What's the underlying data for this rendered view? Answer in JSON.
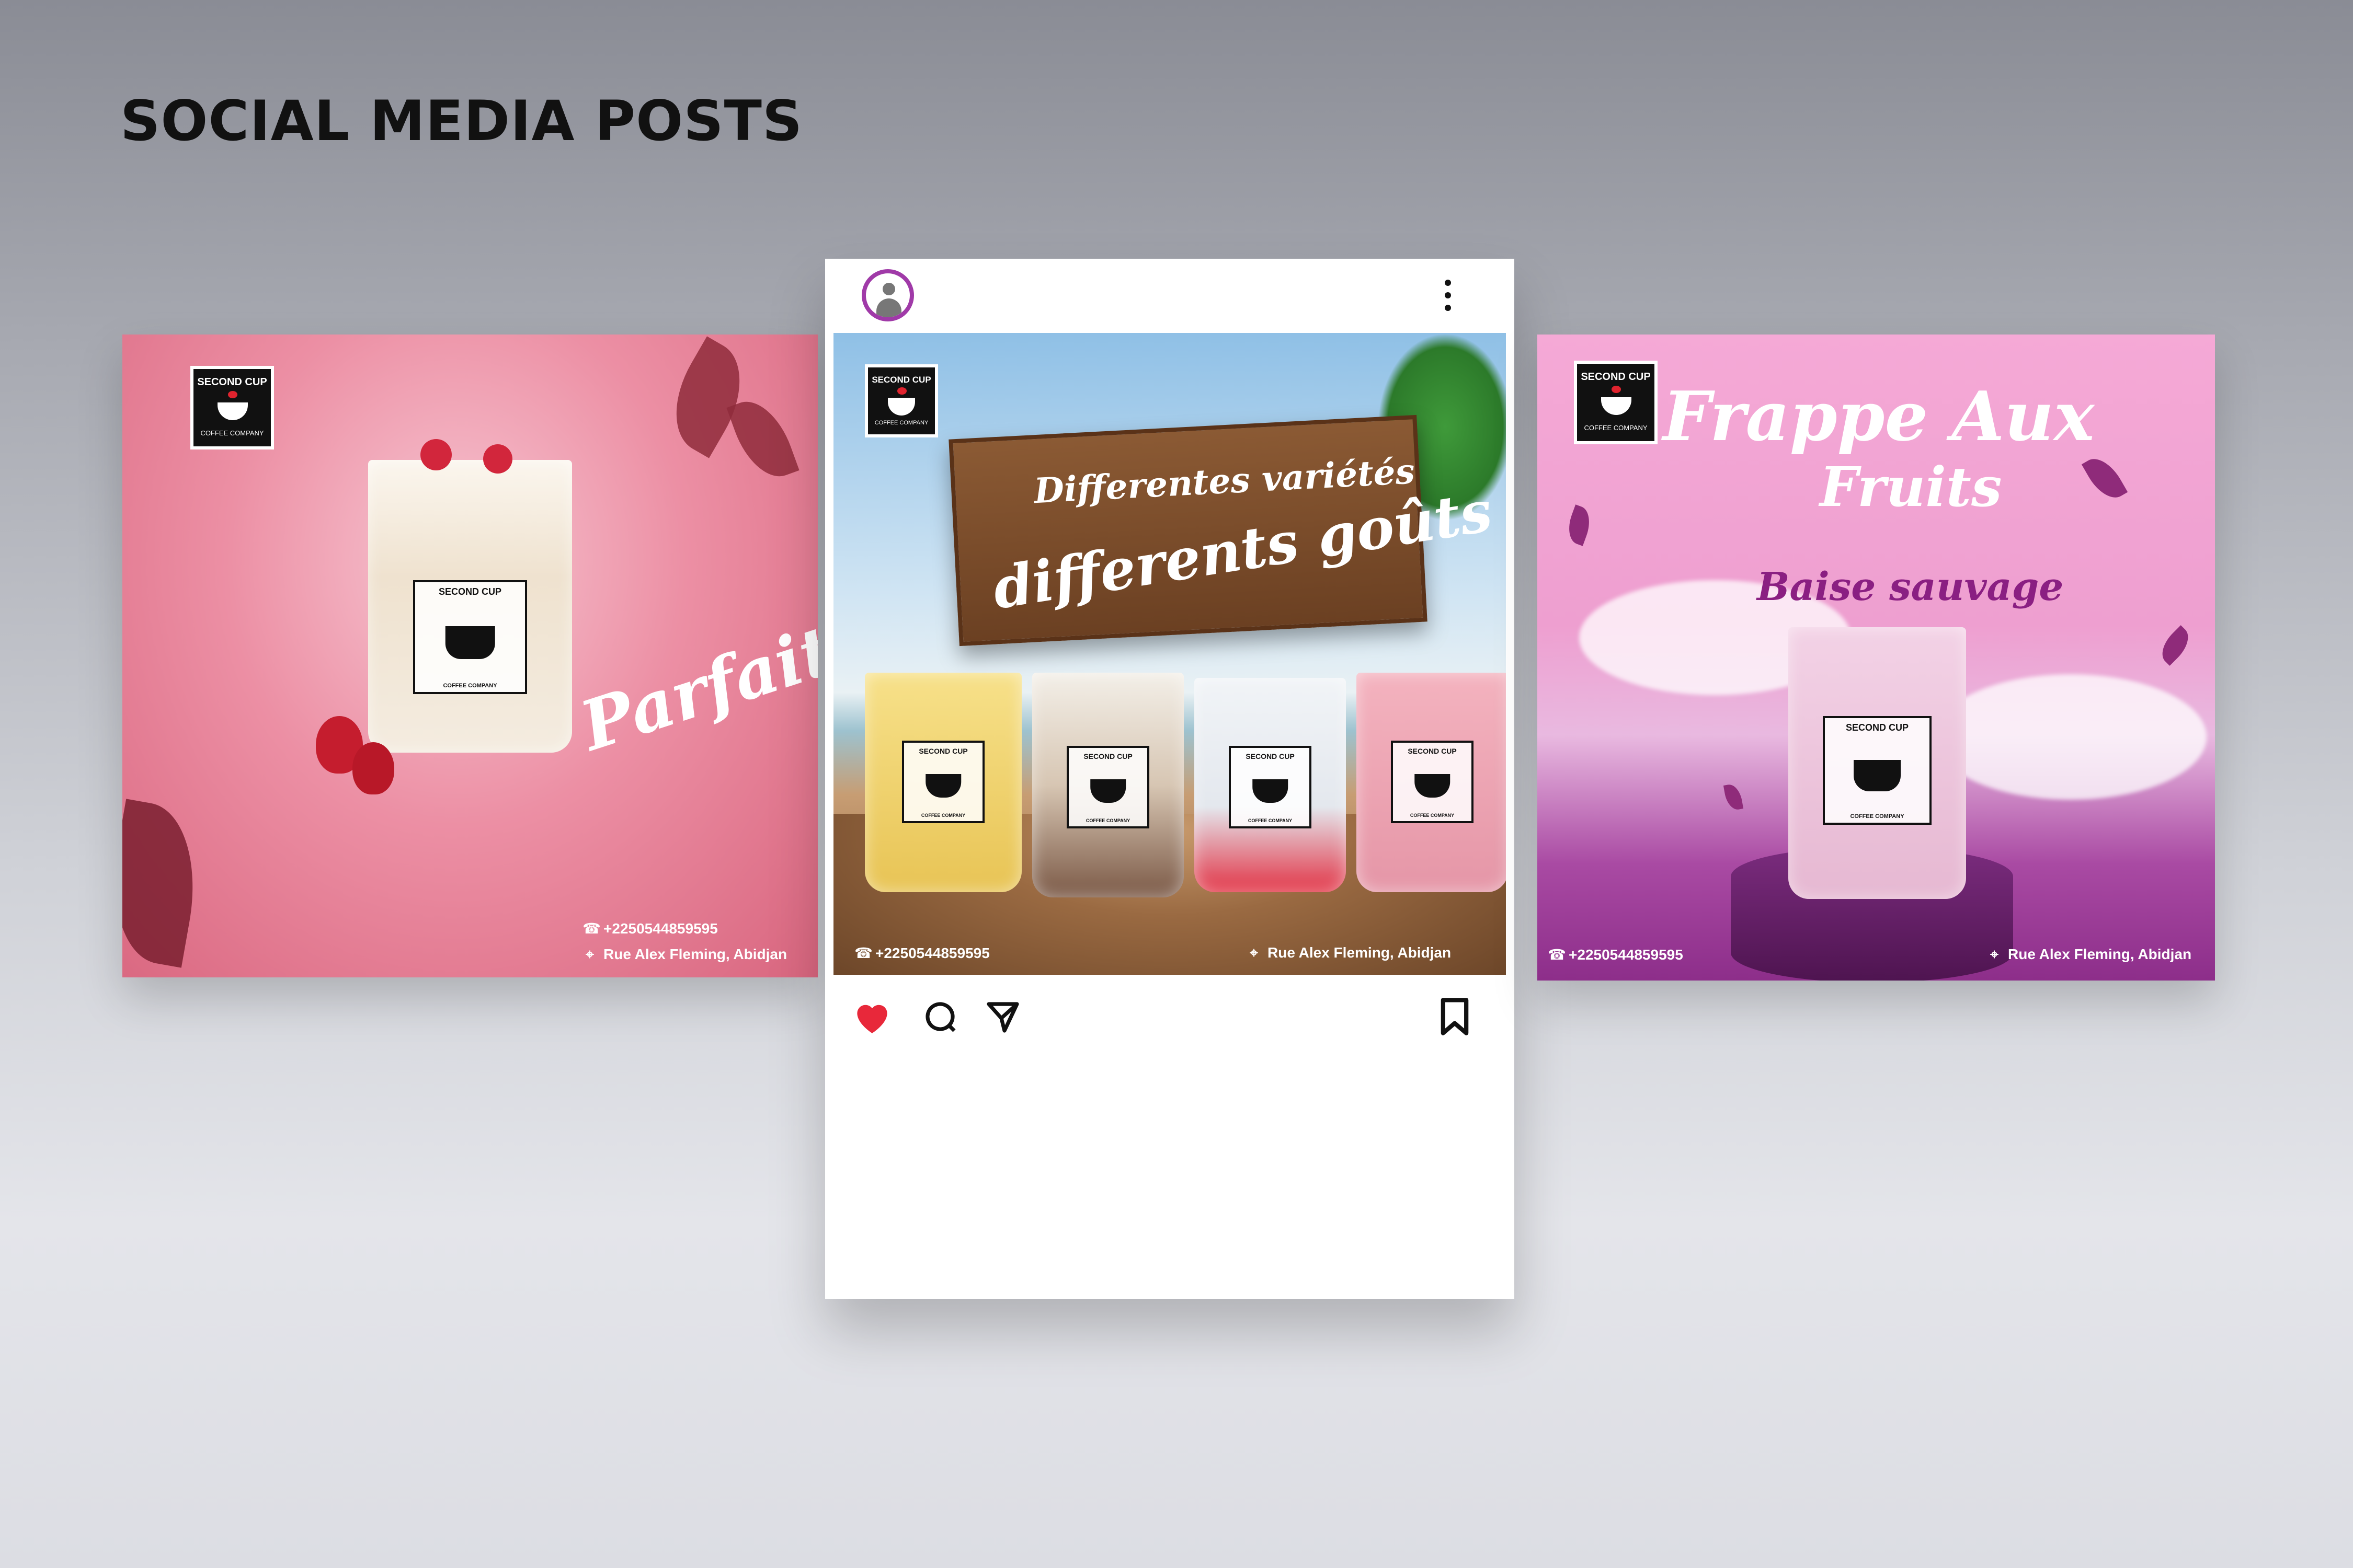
{
  "heading": "SOCIAL MEDIA POSTS",
  "brand": {
    "name_top": "SECOND CUP",
    "name_bottom": "COFFEE COMPANY"
  },
  "contact": {
    "phone": "+2250544859595",
    "address": "Rue Alex Fleming, Abidjan"
  },
  "posts": {
    "left": {
      "title": "Parfait"
    },
    "center": {
      "line1": "Differentes variétés",
      "line2": "differents goûts"
    },
    "right": {
      "title1": "Frappe Aux",
      "title2": "Fruits",
      "subtitle": "Baise sauvage"
    }
  },
  "icons": {
    "phone": "☎",
    "location": "⌖",
    "like": "heart-icon",
    "comment": "comment-icon",
    "share": "send-icon",
    "save": "bookmark-icon",
    "more": "more-vertical-icon"
  },
  "colors": {
    "like": "#e8283a",
    "avatar_ring": "#a03aa8"
  }
}
